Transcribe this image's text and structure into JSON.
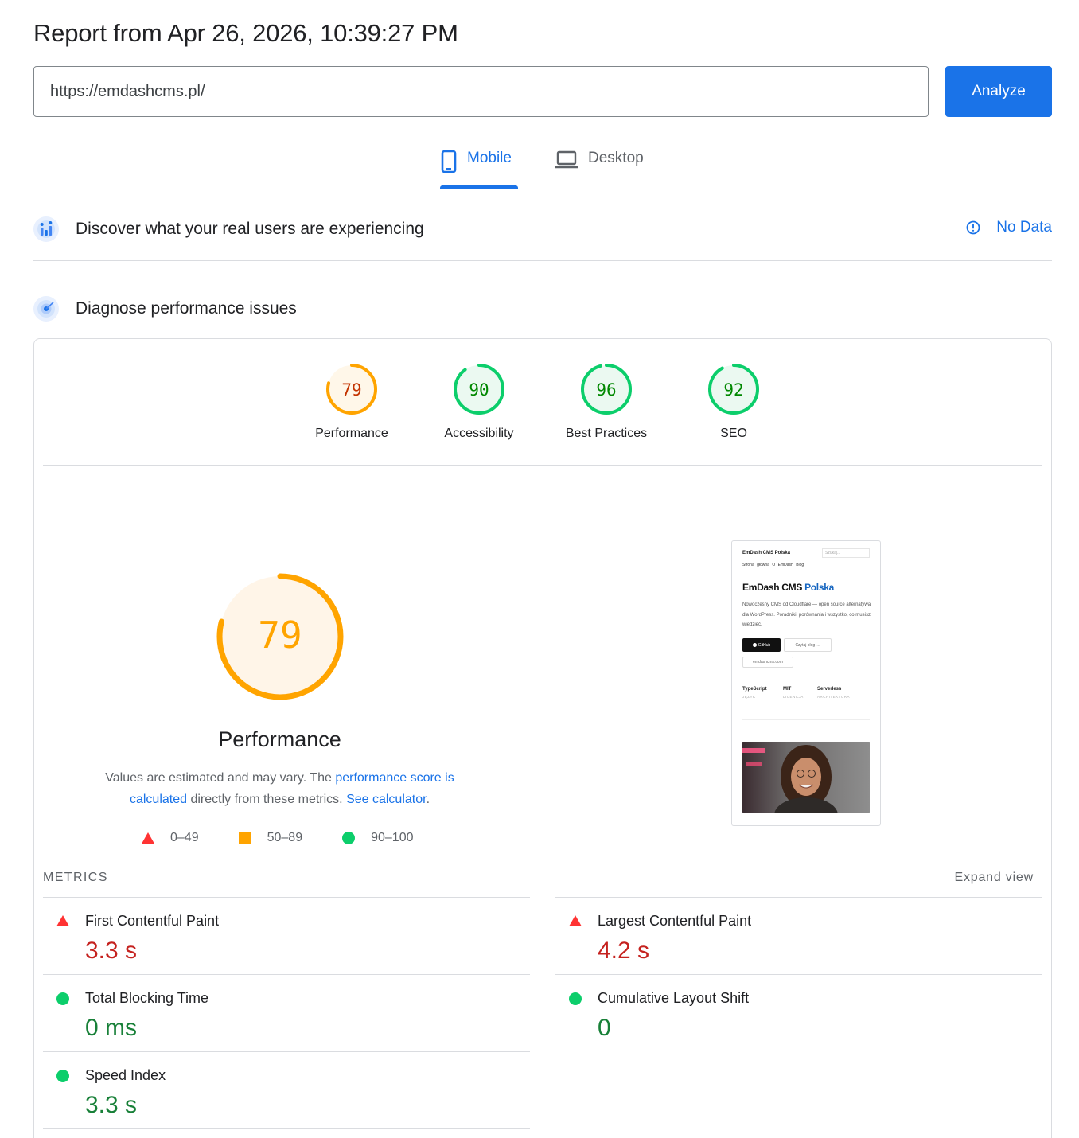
{
  "header": {
    "title": "Report from Apr 26, 2026, 10:39:27 PM"
  },
  "search": {
    "value": "https://emdashcms.pl/",
    "button": "Analyze"
  },
  "tabs": [
    {
      "label": "Mobile",
      "icon": "smartphone-icon",
      "active": true
    },
    {
      "label": "Desktop",
      "icon": "laptop-icon",
      "active": false
    }
  ],
  "field_data": {
    "title": "Discover what your real users are experiencing",
    "status": "No Data"
  },
  "diagnose": {
    "title": "Diagnose performance issues"
  },
  "scores": [
    {
      "label": "Performance",
      "score": "79",
      "level": "average"
    },
    {
      "label": "Accessibility",
      "score": "90",
      "level": "pass"
    },
    {
      "label": "Best Practices",
      "score": "96",
      "level": "pass"
    },
    {
      "label": "SEO",
      "score": "92",
      "level": "pass"
    }
  ],
  "performance": {
    "score": "79",
    "title": "Performance",
    "desc_1": "Values are estimated and may vary. The ",
    "link_1": "performance score is calculated",
    "desc_2": " directly from these metrics. ",
    "link_2": "See calculator",
    "desc_3": "."
  },
  "legend": [
    {
      "range": "0–49",
      "shape": "triangle"
    },
    {
      "range": "50–89",
      "shape": "square"
    },
    {
      "range": "90–100",
      "shape": "circle"
    }
  ],
  "screenshot": {
    "brand": "EmDash CMS Polska",
    "search_placeholder": "Szukaj...",
    "nav": "Strona główna   O EmDash   Blog",
    "heading_1": "EmDash CMS ",
    "heading_2": "Polska",
    "paragraph": "Nowoczesny CMS od Cloudflare — open source alternatywa dla WordPress. Poradniki, porównania i wszystko, co musisz wiedzieć.",
    "btn_github": "GitHub",
    "btn_blog": "Czytaj blog →",
    "chip": "emdashcms.com",
    "stats": [
      {
        "value": "TypeScript",
        "label": "JĘZYK"
      },
      {
        "value": "MIT",
        "label": "LICENCJA"
      },
      {
        "value": "Serverless",
        "label": "ARCHITEKTURA"
      }
    ]
  },
  "metrics_section": {
    "label": "METRICS",
    "expand": "Expand view"
  },
  "metrics": [
    {
      "name": "First Contentful Paint",
      "value": "3.3 s",
      "rating": "poor"
    },
    {
      "name": "Largest Contentful Paint",
      "value": "4.2 s",
      "rating": "poor"
    },
    {
      "name": "Total Blocking Time",
      "value": "0 ms",
      "rating": "good"
    },
    {
      "name": "Cumulative Layout Shift",
      "value": "0",
      "rating": "good"
    },
    {
      "name": "Speed Index",
      "value": "3.3 s",
      "rating": "good"
    }
  ],
  "colors": {
    "accent": "#1a73e8",
    "fail": "#ff3333",
    "average": "#ffa400",
    "pass": "#0cce6b"
  }
}
